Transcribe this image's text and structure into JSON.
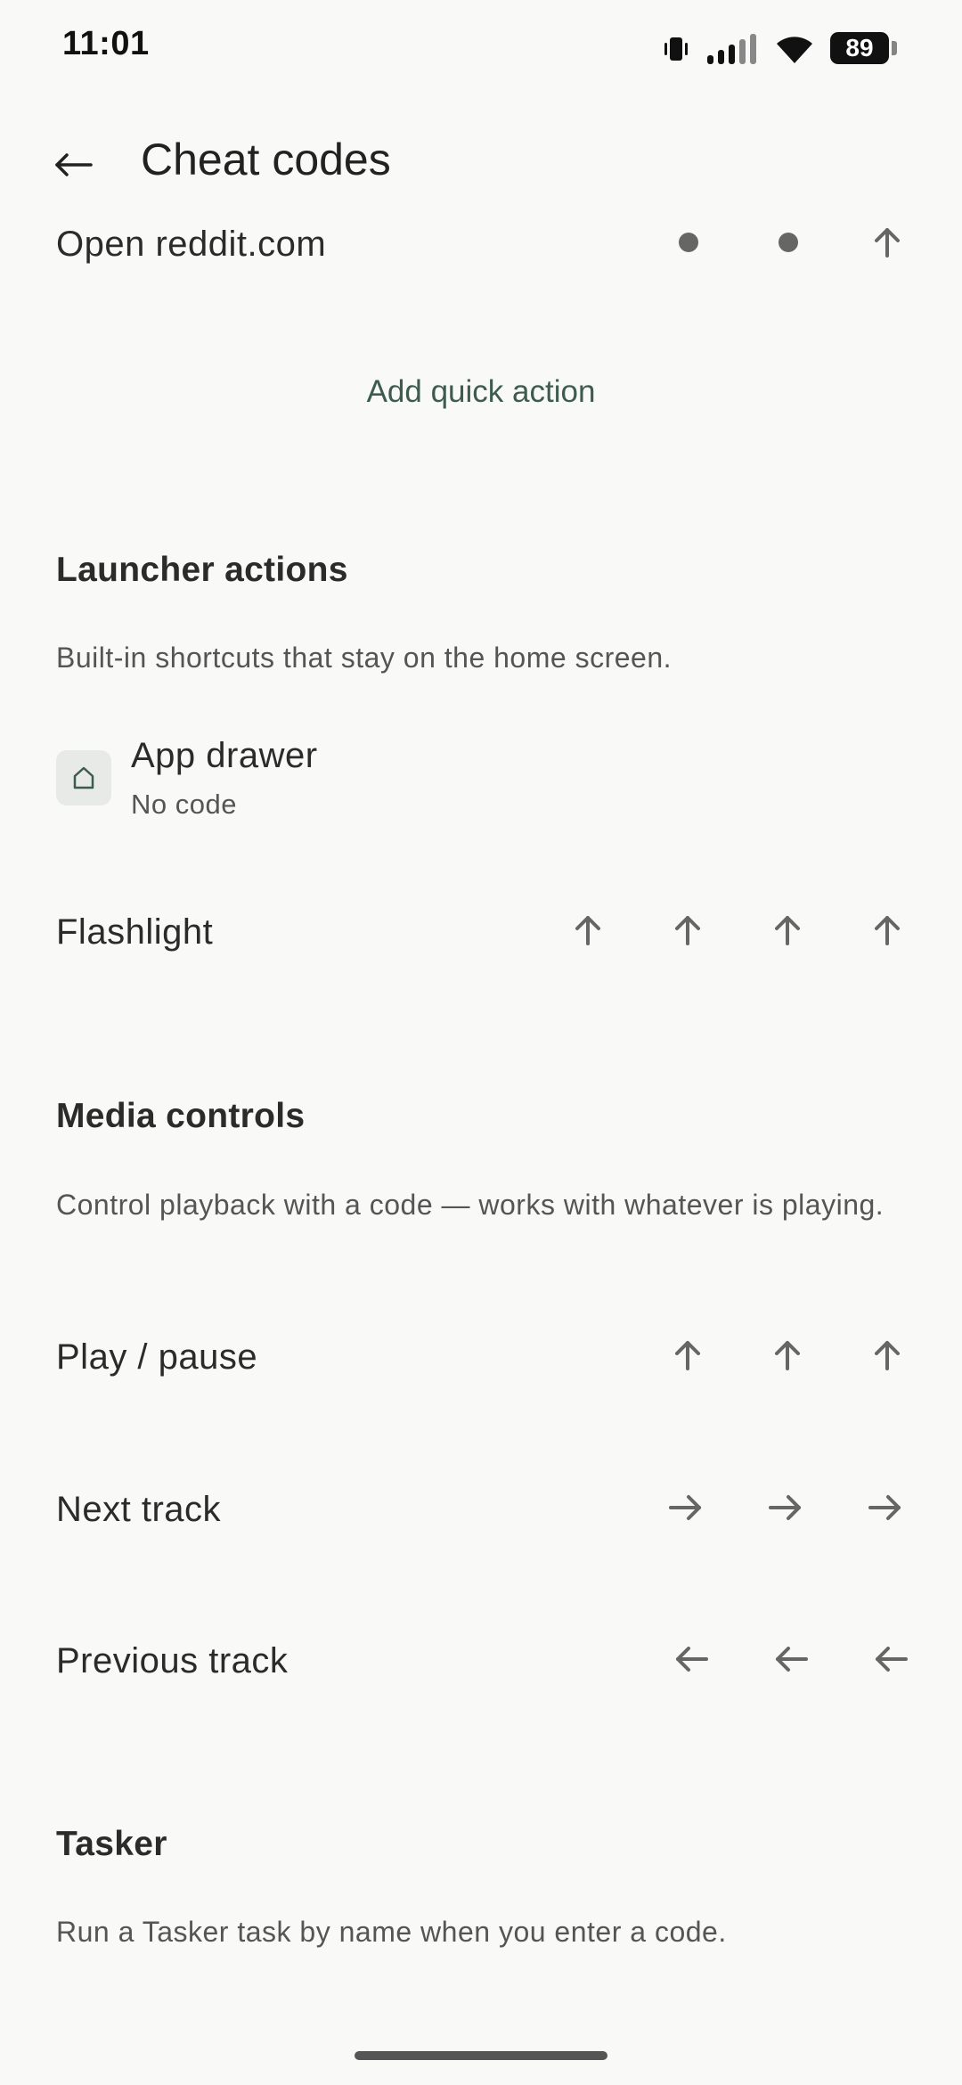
{
  "status_bar": {
    "time": "11:01",
    "battery": "89"
  },
  "app_bar": {
    "title": "Cheat codes"
  },
  "quick_actions": [
    {
      "label": "Open reddit.com",
      "code": [
        "dot",
        "dot",
        "up"
      ]
    }
  ],
  "add_quick_action_label": "Add quick action",
  "launcher": {
    "title": "Launcher actions",
    "description": "Built-in shortcuts that stay on the home screen.",
    "app_drawer": {
      "title": "App drawer",
      "subtitle": "No code"
    },
    "flashlight": {
      "label": "Flashlight",
      "code": [
        "up",
        "up",
        "up",
        "up"
      ]
    }
  },
  "media": {
    "title": "Media controls",
    "description": "Control playback with a code — works with whatever is playing.",
    "items": [
      {
        "label": "Play / pause",
        "code": [
          "up",
          "up",
          "up"
        ]
      },
      {
        "label": "Next track",
        "code": [
          "right",
          "right",
          "right"
        ]
      },
      {
        "label": "Previous track",
        "code": [
          "left",
          "left",
          "left"
        ]
      }
    ]
  },
  "tasker": {
    "title": "Tasker",
    "description": "Run a Tasker task by name when you enter a code."
  },
  "colors": {
    "background": "#f9f9f7",
    "accent": "#3e5c4e",
    "code_glyph": "#666666"
  },
  "icons": {
    "back": "arrow-left-icon",
    "home": "home-icon",
    "up": "arrow-up-icon",
    "right": "arrow-right-icon",
    "left": "arrow-left-icon",
    "dot": "dot-icon"
  }
}
